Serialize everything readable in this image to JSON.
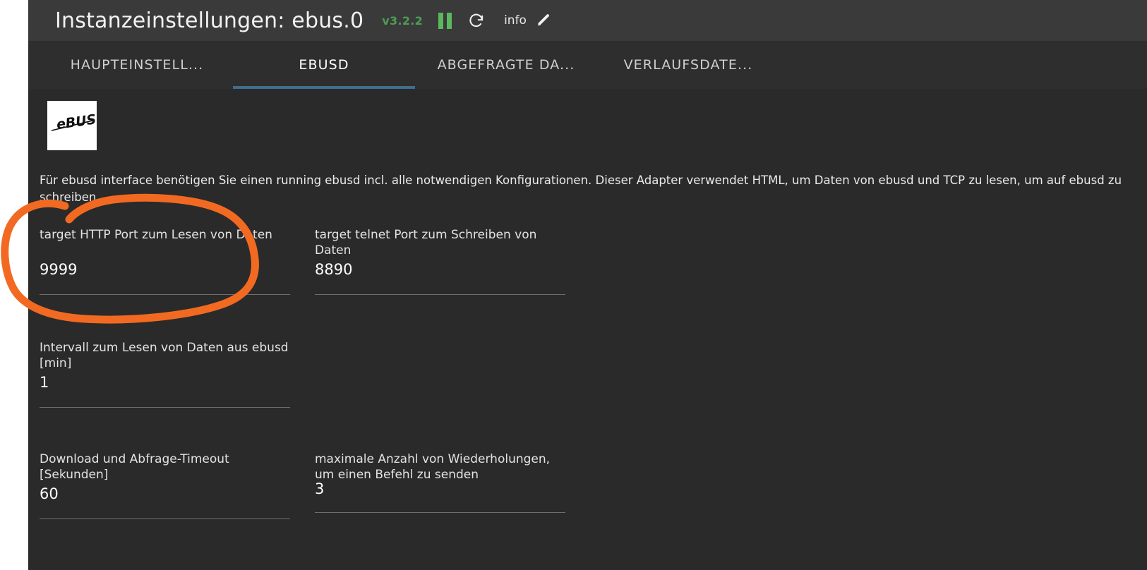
{
  "window": {
    "title": "Instanzeinstellungen: ebus.0",
    "version": "v3.2.2",
    "info_label": "info",
    "icons": {
      "pause": "pause-icon",
      "refresh": "refresh-icon",
      "edit": "pencil-icon"
    }
  },
  "tabs": [
    {
      "label": "HAUPTEINSTELL...",
      "active": false
    },
    {
      "label": "EBUSD",
      "active": true
    },
    {
      "label": "ABGEFRAGTE DA...",
      "active": false
    },
    {
      "label": "VERLAUFSDATE...",
      "active": false
    }
  ],
  "logo": {
    "alt": "ebus-logo",
    "text": "eBUS"
  },
  "description": "Für ebusd interface benötigen Sie einen running ebusd incl. alle notwendigen Konfigurationen. Dieser Adapter verwendet HTML, um Daten von ebusd und TCP zu lesen, um auf ebusd zu schreiben",
  "fields": [
    {
      "label": "target HTTP Port zum Lesen von Daten",
      "value": "9999"
    },
    {
      "label": "target telnet Port zum Schreiben von Daten",
      "value": "8890"
    },
    {
      "label": "Intervall zum Lesen von Daten aus ebusd [min]",
      "value": "1"
    },
    {
      "label": "Download und Abfrage-Timeout [Sekunden]",
      "value": "60"
    },
    {
      "label": "maximale Anzahl von Wiederholungen, um einen Befehl zu senden",
      "value": "3"
    }
  ],
  "annotation": {
    "shape": "hand-drawn-ellipse",
    "color": "#f26a21",
    "targets": "target HTTP Port zum Lesen von Daten"
  },
  "colors": {
    "header_bg": "#3a3a3a",
    "tabbar_bg": "#2e2e2e",
    "content_bg": "#2a2a2a",
    "accent_tab": "#3f6e8f",
    "version_green": "#4f9c54",
    "pause_green": "#5cb85c",
    "annotation_orange": "#f26a21"
  }
}
